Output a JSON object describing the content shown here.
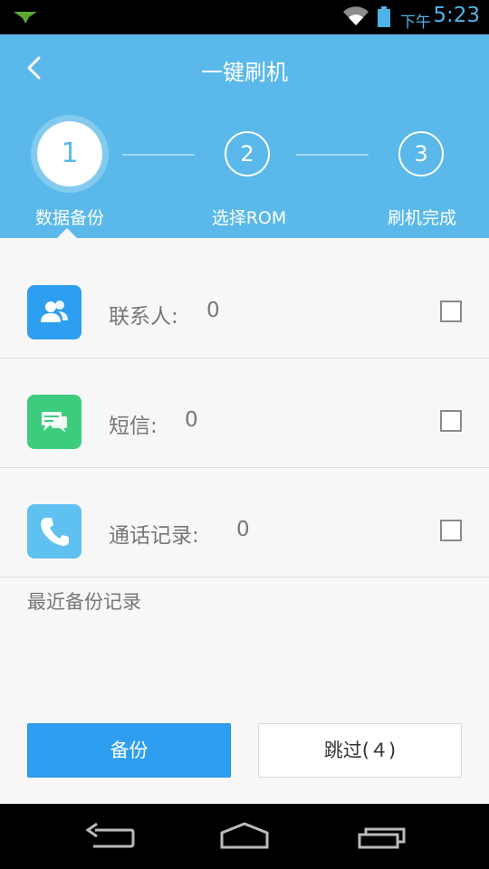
{
  "status_bar": {
    "ampm": "下午",
    "time": "5:23",
    "icons": [
      "notification-icon",
      "wifi-icon",
      "battery-icon"
    ]
  },
  "header": {
    "title": "一键刷机",
    "back_icon": "back-arrow-icon"
  },
  "steps": [
    {
      "number": "1",
      "label": "数据备份",
      "active": true
    },
    {
      "number": "2",
      "label": "选择ROM",
      "active": false
    },
    {
      "number": "3",
      "label": "刷机完成",
      "active": false
    }
  ],
  "items": [
    {
      "label": "联系人:",
      "count": "0",
      "icon": "contacts-icon",
      "color": "#2e9ef0",
      "checked": false
    },
    {
      "label": "短信:",
      "count": "0",
      "icon": "sms-icon",
      "color": "#3dcc7e",
      "checked": false
    },
    {
      "label": "通话记录:",
      "count": "0",
      "icon": "phone-icon",
      "color": "#5fc1ef",
      "checked": false
    }
  ],
  "recent_title": "最近备份记录",
  "buttons": {
    "backup": "备份",
    "skip": "跳过(４)"
  },
  "colors": {
    "header": "#5ab9ea",
    "primary_button": "#2e9ef0"
  },
  "navbar": [
    "back-nav-icon",
    "home-nav-icon",
    "recents-nav-icon"
  ]
}
